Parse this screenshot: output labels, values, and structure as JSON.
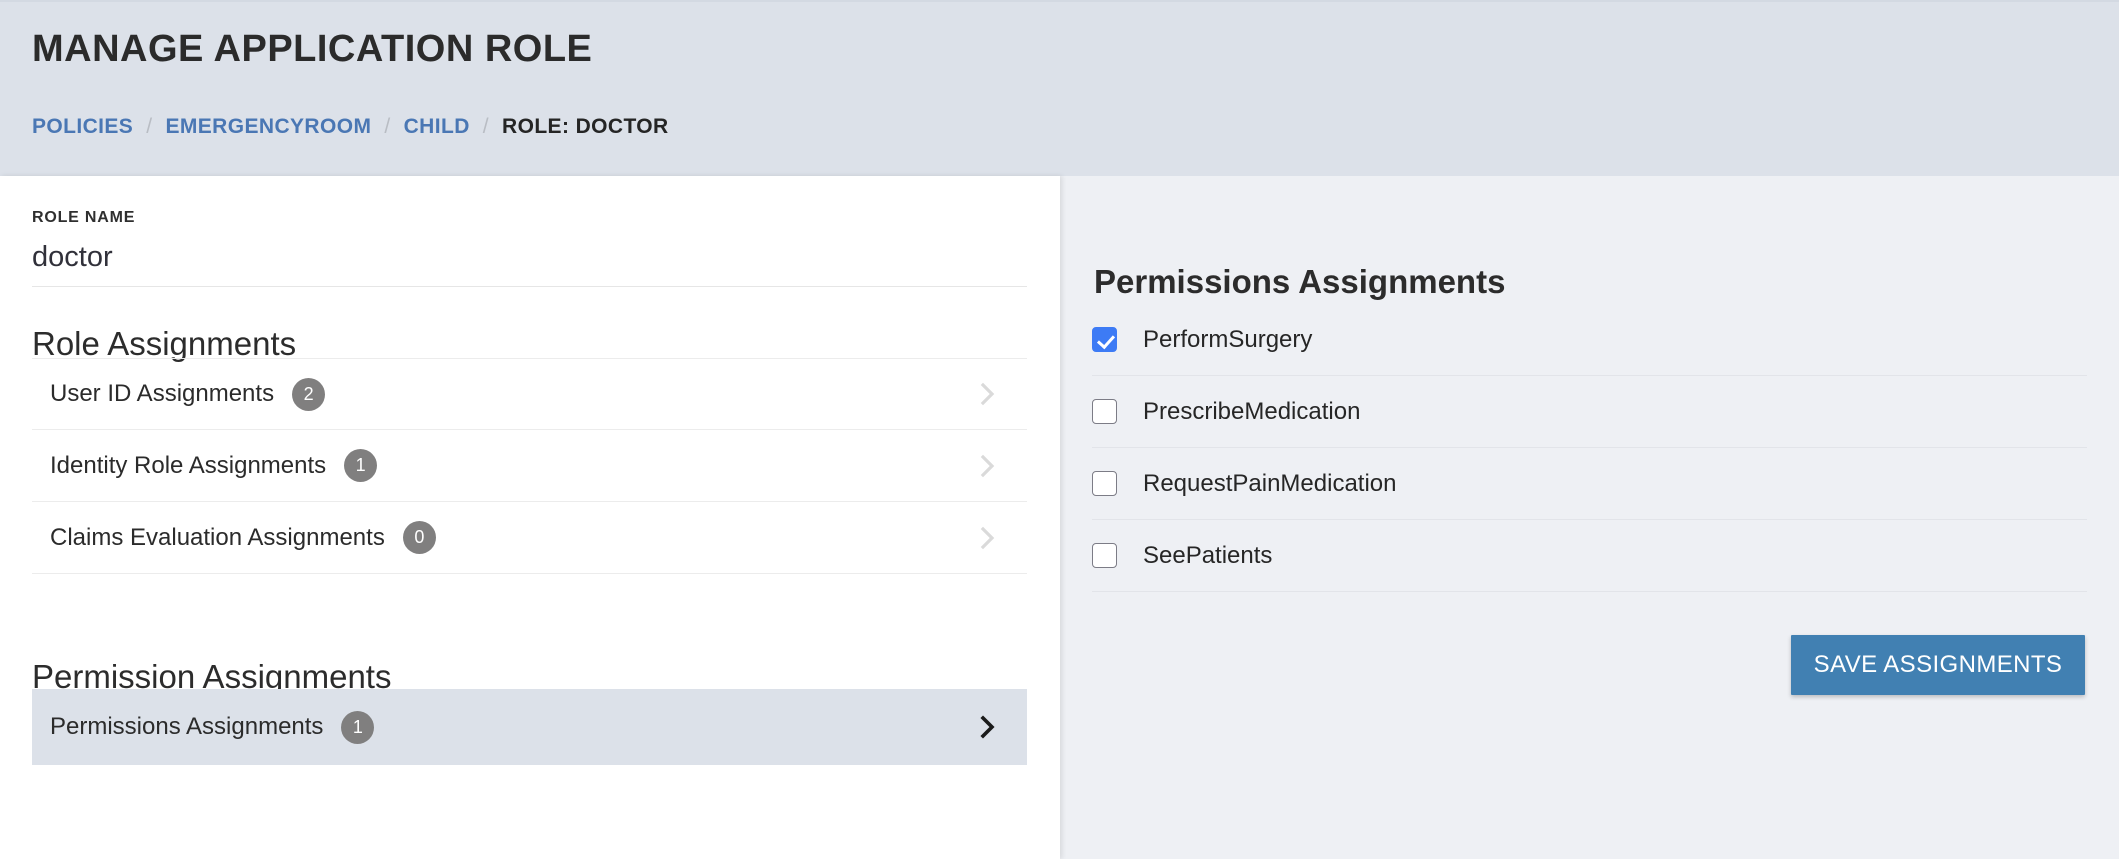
{
  "header": {
    "title": "MANAGE APPLICATION ROLE",
    "breadcrumb": {
      "separator": "/",
      "items": [
        {
          "label": "POLICIES",
          "current": false
        },
        {
          "label": "EMERGENCYROOM",
          "current": false
        },
        {
          "label": "CHILD",
          "current": false
        },
        {
          "label": "ROLE: DOCTOR",
          "current": true
        }
      ]
    },
    "background_color": "#dce1e9",
    "link_color": "#4a77b4"
  },
  "left_pane": {
    "role_name": {
      "label": "ROLE NAME",
      "value": "doctor",
      "placeholder": "Role name"
    },
    "role_assignments": {
      "heading": "Role Assignments",
      "rows": [
        {
          "label": "User ID Assignments",
          "count": "2",
          "chevron_icon": "chevron-right-icon",
          "selected": false
        },
        {
          "label": "Identity Role Assignments",
          "count": "1",
          "chevron_icon": "chevron-right-icon",
          "selected": false
        },
        {
          "label": "Claims Evaluation Assignments",
          "count": "0",
          "chevron_icon": "chevron-right-icon",
          "selected": false
        }
      ]
    },
    "permission_assignments": {
      "heading": "Permission Assignments",
      "rows": [
        {
          "label": "Permissions Assignments",
          "count": "1",
          "chevron_icon": "chevron-right-icon",
          "selected": true
        }
      ]
    },
    "badge_color": "#807f7f",
    "selected_row_color": "#dce1e9"
  },
  "right_pane": {
    "heading": "Permissions Assignments",
    "background_color": "#eef0f4",
    "permissions": [
      {
        "label": "PerformSurgery",
        "checked": true,
        "icon": "checkbox-checked-icon"
      },
      {
        "label": "PrescribeMedication",
        "checked": false,
        "icon": "checkbox-unchecked-icon"
      },
      {
        "label": "RequestPainMedication",
        "checked": false,
        "icon": "checkbox-unchecked-icon"
      },
      {
        "label": "SeePatients",
        "checked": false,
        "icon": "checkbox-unchecked-icon"
      }
    ],
    "save_button": {
      "label": "SAVE ASSIGNMENTS",
      "color": "#4180b2",
      "text_color": "#ffffff"
    },
    "checkbox_checked_color": "#3d7bf5"
  }
}
